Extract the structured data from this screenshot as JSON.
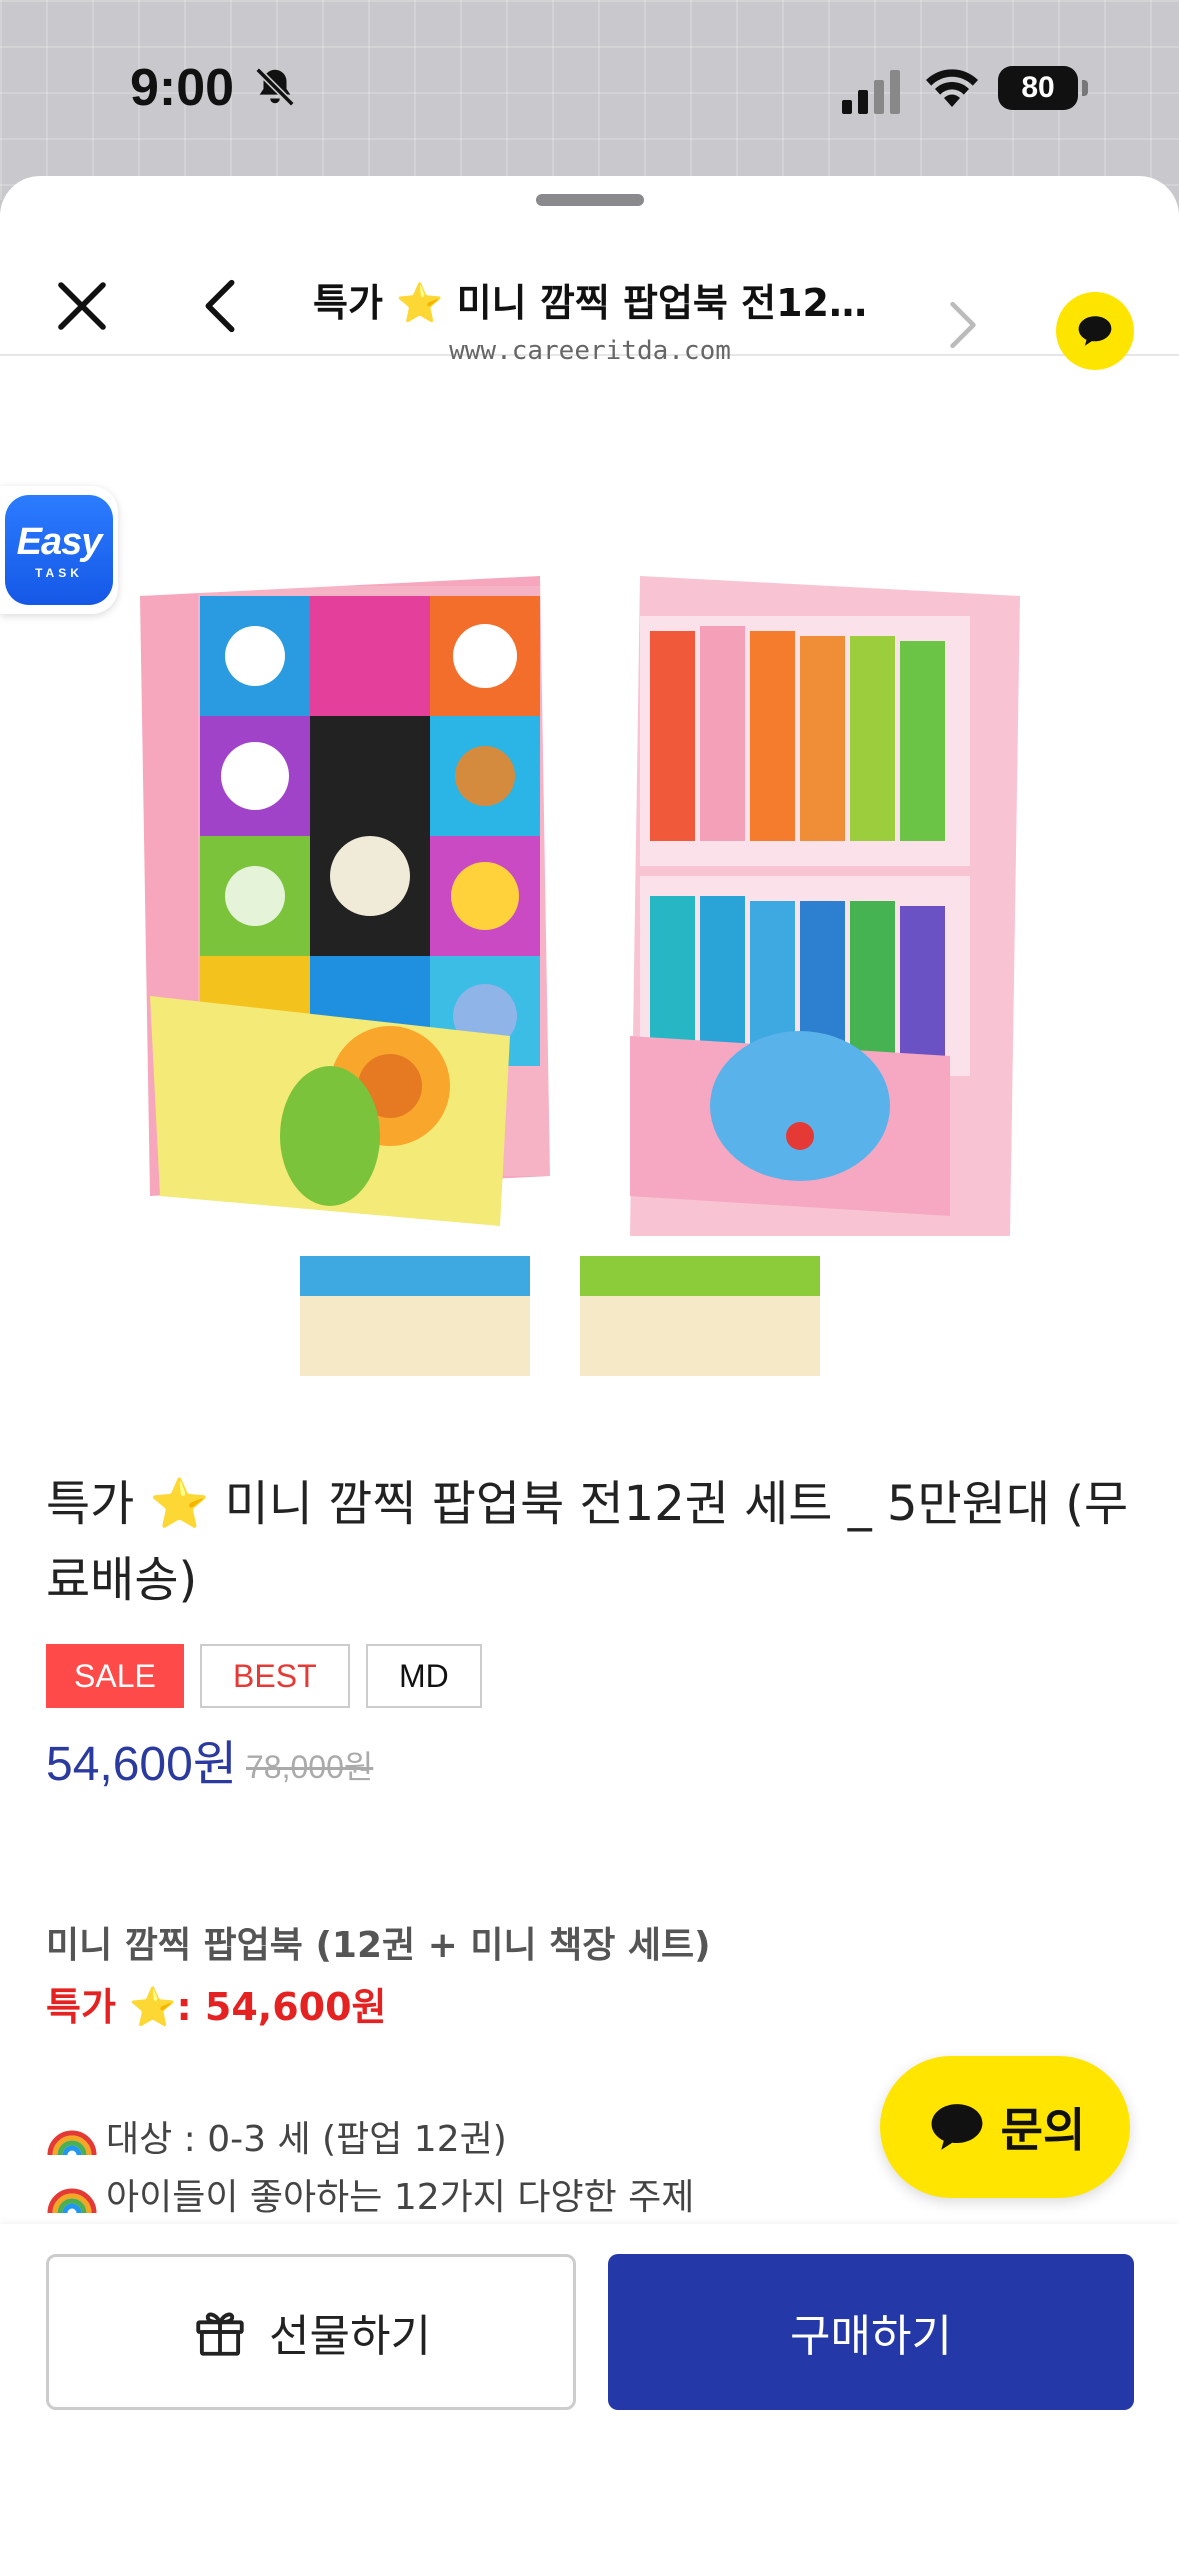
{
  "status": {
    "time": "9:00",
    "battery": "80"
  },
  "nav": {
    "title": "특가 ⭐ 미니 깜찍 팝업북 전12…",
    "url": "www.careeritda.com"
  },
  "easy_badge": {
    "word": "Easy",
    "sub": "TASK"
  },
  "product": {
    "title": "특가 ⭐ 미니 깜찍 팝업북 전12권 세트 _ 5만원대 (무료배송)",
    "tags": [
      "SALE",
      "BEST",
      "MD"
    ],
    "price": "54,600원",
    "original_price": "78,000원",
    "desc_name": "미니 깜찍 팝업북 (12권 + 미니 책장 세트)",
    "desc_special": "특가 ⭐: 54,600원",
    "bullets": [
      "대상 : 0-3 세 (팝업 12권)",
      "아이들이 좋아하는 12가지 다양한 주제"
    ]
  },
  "buttons": {
    "inquiry": "문의",
    "gift": "선물하기",
    "buy": "구매하기"
  },
  "colors": {
    "accent_blue": "#2438a8",
    "sale_red": "#ff4a4a",
    "kakao_yellow": "#fee500"
  }
}
